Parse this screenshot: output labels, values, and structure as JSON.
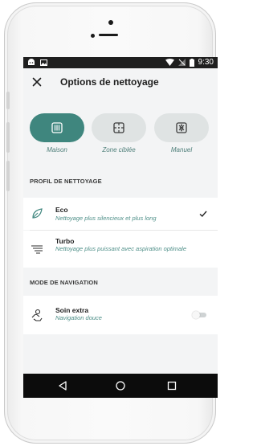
{
  "status_bar": {
    "time": "9:30",
    "left_icons": [
      "android-icon",
      "image-icon"
    ],
    "right_icons": [
      "wifi-icon",
      "no-signal-icon",
      "battery-icon"
    ]
  },
  "header": {
    "title": "Options de nettoyage",
    "close_icon": "close-icon"
  },
  "modes": [
    {
      "label": "Maison",
      "icon": "house-grid-icon",
      "active": true
    },
    {
      "label": "Zone ciblée",
      "icon": "target-zone-icon",
      "active": false
    },
    {
      "label": "Manuel",
      "icon": "manual-icon",
      "active": false
    }
  ],
  "cleaning_profile": {
    "heading": "PROFIL DE NETTOYAGE",
    "items": [
      {
        "title": "Eco",
        "subtitle": "Nettoyage plus silencieux et plus long",
        "icon": "leaf-icon",
        "selected": true
      },
      {
        "title": "Turbo",
        "subtitle": "Nettoyage plus puissant avec aspiration optimale",
        "icon": "speed-lines-icon",
        "selected": false
      }
    ]
  },
  "navigation_mode": {
    "heading": "MODE DE NAVIGATION",
    "items": [
      {
        "title": "Soin extra",
        "subtitle": "Navigation douce",
        "icon": "care-hand-icon",
        "toggle_on": false
      }
    ]
  },
  "colors": {
    "accent": "#3f867e",
    "accent_text": "#4e8f88",
    "pill_inactive": "#dfe3e3",
    "navbar": "#0c0c0c"
  }
}
